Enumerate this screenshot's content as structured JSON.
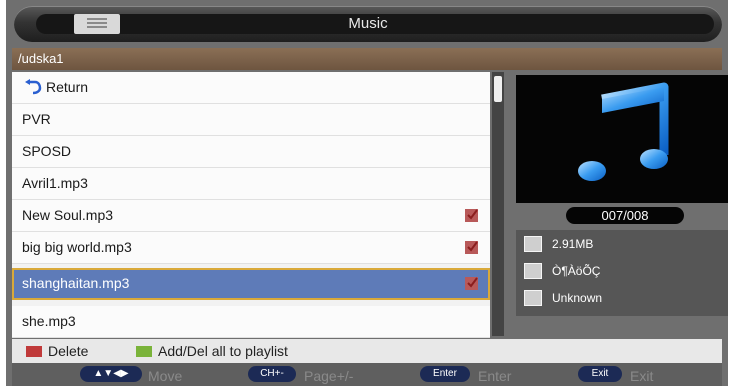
{
  "header": {
    "title": "Music",
    "menu_icon": "menu-list-icon"
  },
  "path": "/udska1",
  "list": {
    "return_label": "Return",
    "items": [
      {
        "label": "PVR",
        "checked": false
      },
      {
        "label": "SPOSD",
        "checked": false
      },
      {
        "label": "Avril1.mp3",
        "checked": false
      },
      {
        "label": "New Soul.mp3",
        "checked": true
      },
      {
        "label": "big big world.mp3",
        "checked": true
      },
      {
        "label": "shanghaitan.mp3",
        "checked": true,
        "selected": true
      },
      {
        "label": "she.mp3",
        "checked": false
      }
    ]
  },
  "preview": {
    "art_icon": "music-note-icon",
    "counter": "007/008",
    "size": "2.91MB",
    "artist": "Ò¶ÀöÕÇ",
    "album": "Unknown"
  },
  "legend": {
    "delete_label": "Delete",
    "add_label": "Add/Del all to playlist",
    "colors": {
      "delete": "#c03a3a",
      "add": "#7ab33a"
    }
  },
  "footer": {
    "move_key": "▲▼◀▶",
    "move_label": "Move",
    "page_key": "CH+-",
    "page_label": "Page+/-",
    "enter_key": "Enter",
    "enter_label": "Enter",
    "exit_key": "Exit",
    "exit_label": "Exit"
  }
}
